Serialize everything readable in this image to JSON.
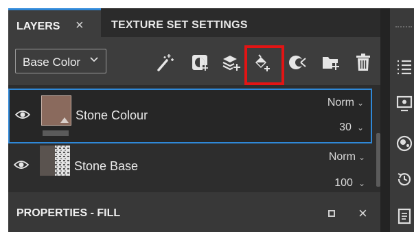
{
  "tabs": {
    "layers": "LAYERS",
    "close": "×",
    "texture_set_settings": "TEXTURE SET SETTINGS"
  },
  "toolbar": {
    "channel": "Base Color",
    "channel_chevron": "⌵",
    "tools": [
      "magic-wand-icon",
      "add-mask-icon",
      "add-layer-icon",
      "add-fill-layer-icon",
      "add-effect-icon",
      "add-folder-icon",
      "delete-icon"
    ],
    "highlighted_tool": "add-fill-layer-icon",
    "highlight_color": "#e31414"
  },
  "layers": [
    {
      "name": "Stone Colour",
      "blend": "Norm",
      "opacity": "30",
      "selected": true,
      "visible": true,
      "thumb_color": "#8a6a5d"
    },
    {
      "name": "Stone Base",
      "blend": "Norm",
      "opacity": "100",
      "selected": false,
      "visible": true
    }
  ],
  "chevron": "⌄",
  "properties": {
    "title": "PROPERTIES - FILL",
    "close": "×"
  },
  "dock": {
    "icons": [
      "list-icon",
      "display-settings-icon",
      "shader-icon",
      "history-icon",
      "log-icon"
    ]
  },
  "colors": {
    "accent": "#2f88d8",
    "panel": "#3d3d3d",
    "list_bg": "#2d2d2d"
  }
}
